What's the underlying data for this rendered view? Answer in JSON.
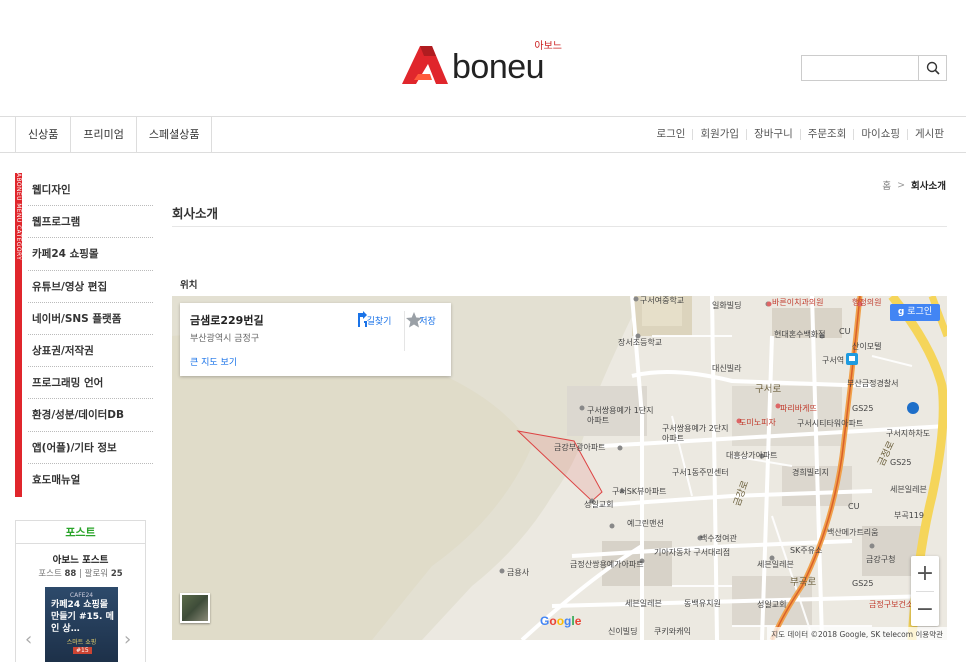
{
  "header": {
    "logo_text": "boneu",
    "logo_sub": "아보느",
    "search": {
      "value": "",
      "placeholder": ""
    }
  },
  "nav": {
    "tabs": [
      "신상품",
      "프리미엄",
      "스페셜상품"
    ],
    "utility": [
      "로그인",
      "회원가입",
      "장바구니",
      "주문조회",
      "마이쇼핑",
      "게시판"
    ]
  },
  "sidebar": {
    "vertical_label": "ABONEU MENU CATEGORY",
    "categories": [
      "웹디자인",
      "웹프로그램",
      "카페24 쇼핑몰",
      "유튜브/영상 편집",
      "네이버/SNS 플랫폼",
      "상표권/저작권",
      "프로그래밍 언어",
      "환경/성분/데이터DB",
      "앱(어플)/기타 정보",
      "효도매뉴얼"
    ],
    "post": {
      "title": "포스트",
      "name": "아보느 포스트",
      "posts_label": "포스트",
      "posts_count": "88",
      "followers_label": "팔로워",
      "followers_count": "25",
      "thumb_top": "CAFE24",
      "thumb_text": "카페24 쇼핑몰 만들기 #15. 메인 상…",
      "thumb_sub": "스마트 쇼핑",
      "thumb_tag": "#15",
      "prev": "‹",
      "next": "›"
    }
  },
  "main": {
    "breadcrumb": {
      "home": "홈",
      "sep": ">",
      "current": "회사소개"
    },
    "title": "회사소개",
    "section_label": "위치"
  },
  "map": {
    "info": {
      "name": "금샘로229번길",
      "address": "부산광역시 금정구",
      "large_map_link": "큰 지도 보기",
      "directions": "길찾기",
      "save": "저장"
    },
    "login": "로그인",
    "zoom_in": "+",
    "zoom_out": "−",
    "google": "Google",
    "attribution": "지도 데이터 ©2018 Google, SK telecom   이용약관",
    "labels": [
      "구서여중학교",
      "일화빌딩",
      "바른이치과의원",
      "행정의원",
      "장서초등학교",
      "현대혼수백화점",
      "CU",
      "산이모텔",
      "구서역",
      "대신빌라",
      "구서로",
      "부산금정경찰서",
      "구서쌍용예가 1단지아파트",
      "파리바게뜨",
      "GS25",
      "도미노피자",
      "구서시티타워아파트",
      "구서쌍용예가 2단지아파트",
      "금강부광아파트",
      "대흥상가아파트",
      "구서지하차도",
      "구서1동주민센터",
      "경희빌리지",
      "구서SK뷰아파트",
      "GS25",
      "세븐일레븐",
      "성일교회",
      "예그린맨션",
      "CU",
      "백수정여관",
      "백산메가트리움",
      "기아자동차 구서대리점",
      "SK주유소",
      "금정산쌍용예가아파트",
      "세븐일레븐",
      "금강구청",
      "금용사",
      "부곡로",
      "GS25",
      "세븐일레븐",
      "동백유치원",
      "성일교회",
      "신이빌딩",
      "쿠키와캐익",
      "금정구보건소",
      "부곡119",
      "금강로",
      "금정로"
    ]
  },
  "colors": {
    "accent_red": "#e0262c",
    "post_green": "#2aa42a",
    "google_blue": "#4285f4",
    "link_blue": "#1a73e8"
  }
}
